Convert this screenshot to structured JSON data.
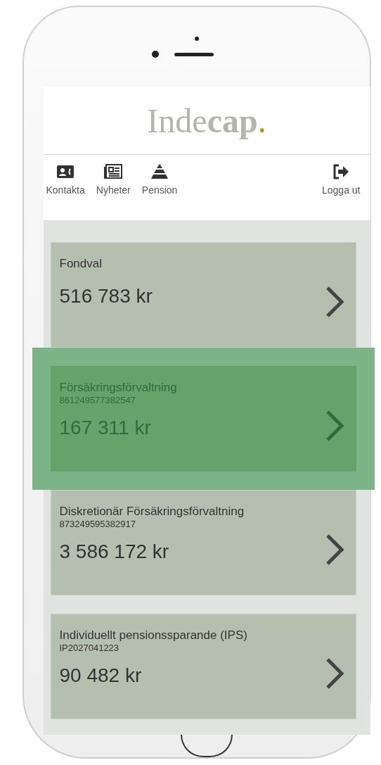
{
  "logo": {
    "light": "Inde",
    "bold": "cap",
    "dot": "."
  },
  "nav": [
    {
      "kind": "contact",
      "label": "Kontakta"
    },
    {
      "kind": "news",
      "label": "Nyheter"
    },
    {
      "kind": "pension",
      "label": "Pension"
    },
    {
      "kind": "logout",
      "label": "Logga ut"
    }
  ],
  "accounts": [
    {
      "title": "Fondval",
      "amount": "516 783 kr",
      "selected": false
    },
    {
      "title": "Försäkringsförvaltning",
      "number": "861249577382547",
      "amount": "167 311 kr",
      "selected": true
    },
    {
      "title": "Diskretionär Försäkringsförvaltning",
      "number": "873249595382917",
      "amount": "3 586 172 kr",
      "selected": false
    },
    {
      "title": "Individuellt pensionssparande (IPS)",
      "number": "IP2027041223",
      "amount": "90 482 kr",
      "selected": false
    }
  ]
}
